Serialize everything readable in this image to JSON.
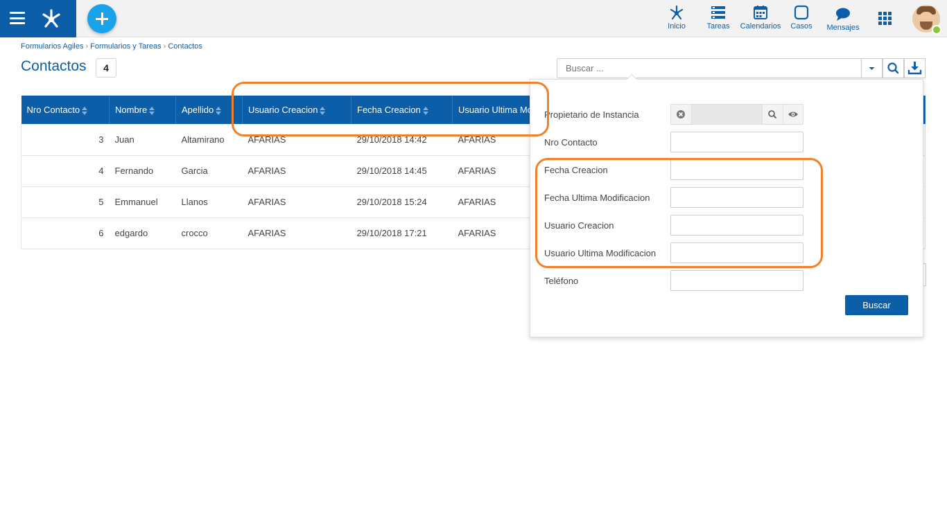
{
  "header": {
    "nav": [
      {
        "label": "Inicio",
        "icon": "home-nodes-icon"
      },
      {
        "label": "Tareas",
        "icon": "tasks-icon"
      },
      {
        "label": "Calendarios",
        "icon": "calendar-icon"
      },
      {
        "label": "Casos",
        "icon": "cases-icon"
      },
      {
        "label": "Mensajes",
        "icon": "message-icon"
      }
    ]
  },
  "breadcrumb": [
    "Formularios Agiles",
    "Formularios y Tareas",
    "Contactos"
  ],
  "page": {
    "title": "Contactos",
    "count": "4"
  },
  "search": {
    "placeholder": "Buscar ..."
  },
  "table": {
    "columns": [
      "Nro Contacto",
      "Nombre",
      "Apellido",
      "Usuario Creacion",
      "Fecha Creacion",
      "Usuario Ultima Mo"
    ],
    "rows": [
      [
        "3",
        "Juan",
        "Altamirano",
        "AFARIAS",
        "29/10/2018 14:42",
        "AFARIAS"
      ],
      [
        "4",
        "Fernando",
        "Garcia",
        "AFARIAS",
        "29/10/2018 14:45",
        "AFARIAS"
      ],
      [
        "5",
        "Emmanuel",
        "Llanos",
        "AFARIAS",
        "29/10/2018 15:24",
        "AFARIAS"
      ],
      [
        "6",
        "edgardo",
        "crocco",
        "AFARIAS",
        "29/10/2018 17:21",
        "AFARIAS"
      ]
    ]
  },
  "filter": {
    "fields": [
      "Propietario de Instancia",
      "Nro Contacto",
      "Fecha Creacion",
      "Fecha Ultima Modificacion",
      "Usuario Creacion",
      "Usuario Ultima Modificacion",
      "Teléfono"
    ],
    "search_button": "Buscar"
  },
  "colors": {
    "primary": "#0d5ea8",
    "accent": "#1aa3e8",
    "highlight": "#f0802a",
    "online": "#8cc63f"
  }
}
